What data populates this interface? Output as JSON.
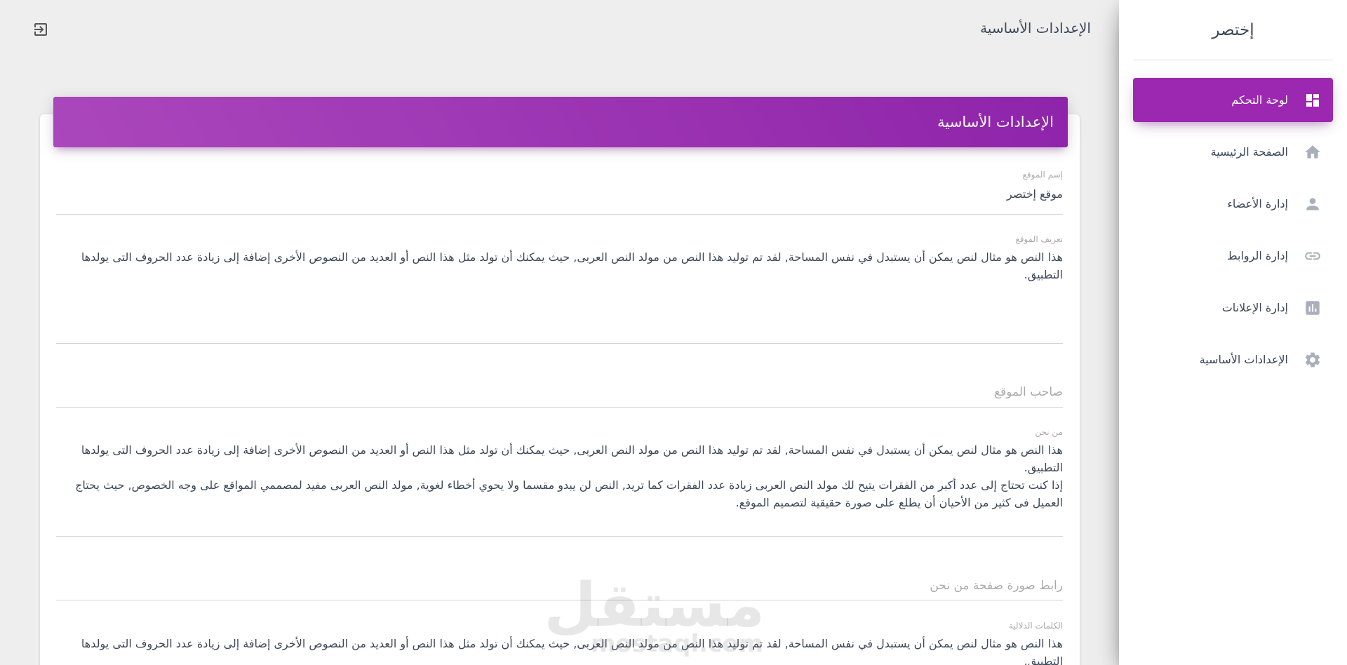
{
  "brand": {
    "name": "إختصر"
  },
  "sidebar": {
    "items": [
      {
        "label": "لوحة التحكم",
        "icon": "dashboard-icon",
        "active": true
      },
      {
        "label": "الصفحة الرئيسية",
        "icon": "home-icon",
        "active": false
      },
      {
        "label": "إدارة الأعضاء",
        "icon": "person-icon",
        "active": false
      },
      {
        "label": "إدارة الروابط",
        "icon": "link-icon",
        "active": false
      },
      {
        "label": "إدارة الإعلانات",
        "icon": "bar-chart-icon",
        "active": false
      },
      {
        "label": "الإعدادات الأساسية",
        "icon": "gear-icon",
        "active": false
      }
    ]
  },
  "topbar": {
    "title": "الإعدادات الأساسية",
    "logout_icon": "logout-icon"
  },
  "card": {
    "title": "الإعدادات الأساسية"
  },
  "form": {
    "site_name": {
      "label": "إسم الموقع",
      "value": "موقع إختصر"
    },
    "site_description": {
      "label": "تعريف الموقع",
      "value": "هذا النص هو مثال لنص يمكن أن يستبدل في نفس المساحة, لقد تم توليد هذا النص من مولد النص العربى, حيث يمكنك أن تولد مثل هذا النص أو العديد من النصوص الأخرى إضافة إلى زيادة عدد الحروف التى يولدها التطبيق."
    },
    "site_owner": {
      "placeholder": "صاحب الموقع"
    },
    "about_us": {
      "label": "من نحن",
      "value": "هذا النص هو مثال لنص يمكن أن يستبدل في نفس المساحة, لقد تم توليد هذا النص من مولد النص العربى, حيث يمكنك أن تولد مثل هذا النص أو العديد من النصوص الأخرى إضافة إلى زيادة عدد الحروف التى يولدها التطبيق.\nإذا كنت تحتاج إلى عدد أكبر من الفقرات يتيح لك مولد النص العربى زيادة عدد الفقرات كما تريد, النص لن يبدو مقسما ولا يحوي أخطاء لغوية, مولد النص العربى مفيد لمصممي المواقع على وجه الخصوص, حيث يحتاج العميل فى كثير من الأحيان أن يطلع على صورة حقيقية لتصميم الموقع."
    },
    "about_image_link": {
      "placeholder": "رابط صورة صفحة من نحن"
    },
    "keywords": {
      "label": "الكلمات الدلالية",
      "value": "هذا النص هو مثال لنص يمكن أن يستبدل في نفس المساحة, لقد تم توليد هذا النص من مولد النص العربى, حيث يمكنك أن تولد مثل هذا النص أو العديد من النصوص الأخرى إضافة إلى زيادة عدد الحروف التى يولدها التطبيق."
    }
  },
  "watermark": {
    "arabic": "مستقل",
    "latin": "mostaql.com"
  },
  "colors": {
    "accent": "#9c27b0",
    "accent_gradient_start": "#ab47bc",
    "accent_gradient_end": "#8e24aa",
    "icon_gray": "#a9afbb"
  }
}
